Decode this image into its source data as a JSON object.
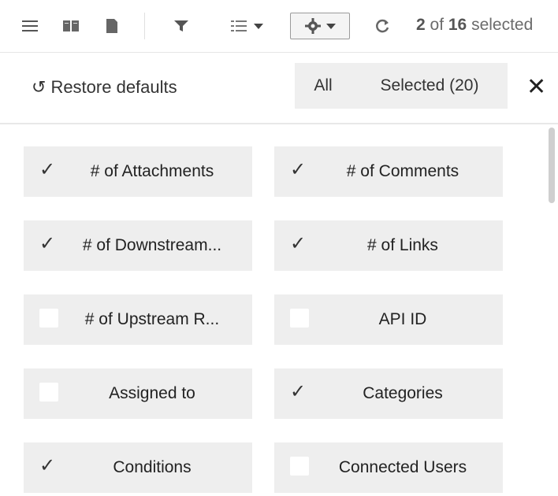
{
  "toolbar": {
    "selection_count_prefix": "2",
    "selection_count_mid": " of ",
    "selection_count_total": "16",
    "selection_count_suffix": " selected",
    "icons": [
      "list-view-icon",
      "book-view-icon",
      "document-view-icon",
      "filter-icon",
      "columns-icon",
      "gear-icon",
      "refresh-icon"
    ]
  },
  "panel": {
    "restore_label": "Restore defaults",
    "restore_icon": "↺",
    "tab_all": "All",
    "tab_selected": "Selected (20)",
    "close_icon": "✕"
  },
  "columns": [
    {
      "label": "# of Attachments",
      "checked": true
    },
    {
      "label": "# of Comments",
      "checked": true
    },
    {
      "label": "# of Downstream...",
      "checked": true
    },
    {
      "label": "# of Links",
      "checked": true
    },
    {
      "label": "# of Upstream R...",
      "checked": false
    },
    {
      "label": "API ID",
      "checked": false
    },
    {
      "label": "Assigned to",
      "checked": false
    },
    {
      "label": "Categories",
      "checked": true
    },
    {
      "label": "Conditions",
      "checked": true
    },
    {
      "label": "Connected Users",
      "checked": false
    }
  ]
}
